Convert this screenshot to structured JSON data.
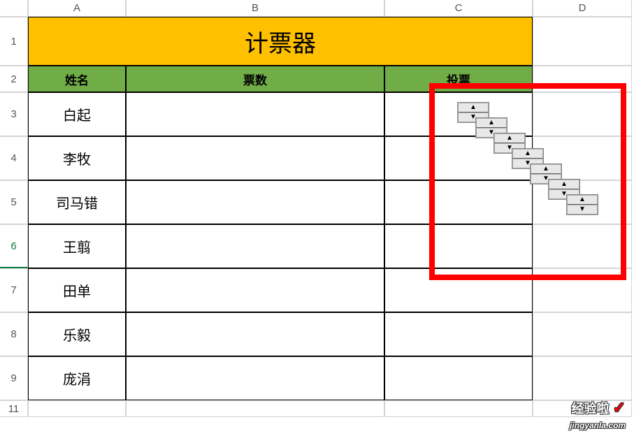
{
  "columns": [
    "A",
    "B",
    "C",
    "D"
  ],
  "rows": [
    "1",
    "2",
    "3",
    "4",
    "5",
    "6",
    "7",
    "8",
    "9",
    "11"
  ],
  "title": "计票器",
  "headers": {
    "name": "姓名",
    "votes": "票数",
    "vote_action": "投票"
  },
  "data": [
    {
      "name": "白起",
      "votes": ""
    },
    {
      "name": "李牧",
      "votes": ""
    },
    {
      "name": "司马错",
      "votes": ""
    },
    {
      "name": "王翦",
      "votes": ""
    },
    {
      "name": "田单",
      "votes": ""
    },
    {
      "name": "乐毅",
      "votes": ""
    },
    {
      "name": "庞涓",
      "votes": ""
    }
  ],
  "spinners_count": 7,
  "watermark": {
    "main": "经验啦",
    "check": "✓",
    "sub": "jingyanla.com"
  }
}
